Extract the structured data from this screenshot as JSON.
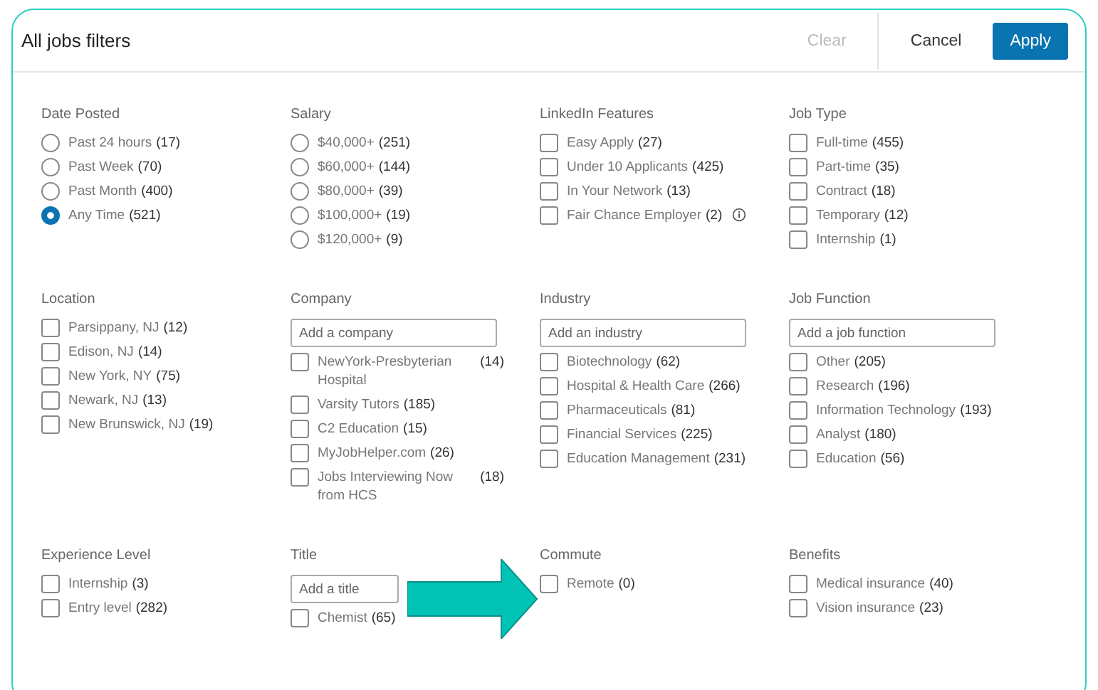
{
  "header": {
    "title": "All jobs filters",
    "buttons": [
      {
        "label": "Clear",
        "kind": "text",
        "disabled": true
      },
      {
        "label": "Cancel",
        "kind": "text",
        "disabled": false
      },
      {
        "label": "Apply",
        "kind": "primary",
        "disabled": false
      }
    ]
  },
  "rows": [
    [
      {
        "title": "Date Posted",
        "kind": "radio",
        "options": [
          {
            "label": "Past 24 hours",
            "count": "(17)",
            "selected": false
          },
          {
            "label": "Past Week",
            "count": "(70)",
            "selected": false
          },
          {
            "label": "Past Month",
            "count": "(400)",
            "selected": false
          },
          {
            "label": "Any Time",
            "count": "(521)",
            "selected": true
          }
        ]
      },
      {
        "title": "Salary",
        "kind": "radio",
        "options": [
          {
            "label": "$40,000+",
            "count": "(251)",
            "selected": false
          },
          {
            "label": "$60,000+",
            "count": "(144)",
            "selected": false
          },
          {
            "label": "$80,000+",
            "count": "(39)",
            "selected": false
          },
          {
            "label": "$100,000+",
            "count": "(19)",
            "selected": false
          },
          {
            "label": "$120,000+",
            "count": "(9)",
            "selected": false
          }
        ]
      },
      {
        "title": "LinkedIn Features",
        "kind": "checkbox",
        "options": [
          {
            "label": "Easy Apply",
            "count": "(27)",
            "checked": false
          },
          {
            "label": "Under 10 Applicants",
            "count": "(425)",
            "checked": false
          },
          {
            "label": "In Your Network",
            "count": "(13)",
            "checked": false
          },
          {
            "label": "Fair Chance Employer",
            "count": "(2)",
            "checked": false,
            "info_icon": true
          }
        ]
      },
      {
        "title": "Job Type",
        "kind": "checkbox",
        "options": [
          {
            "label": "Full-time",
            "count": "(455)",
            "checked": false
          },
          {
            "label": "Part-time",
            "count": "(35)",
            "checked": false
          },
          {
            "label": "Contract",
            "count": "(18)",
            "checked": false
          },
          {
            "label": "Temporary",
            "count": "(12)",
            "checked": false
          },
          {
            "label": "Internship",
            "count": "(1)",
            "checked": false
          }
        ]
      }
    ],
    [
      {
        "title": "Location",
        "kind": "checkbox",
        "options": [
          {
            "label": "Parsippany, NJ",
            "count": "(12)",
            "checked": false
          },
          {
            "label": "Edison, NJ",
            "count": "(14)",
            "checked": false
          },
          {
            "label": "New York, NY",
            "count": "(75)",
            "checked": false
          },
          {
            "label": "Newark, NJ",
            "count": "(13)",
            "checked": false
          },
          {
            "label": "New Brunswick, NJ",
            "count": "(19)",
            "checked": false
          }
        ]
      },
      {
        "title": "Company",
        "kind": "checkbox",
        "placeholder": "Add a company",
        "options": [
          {
            "label": "NewYork-Presbyterian Hospital",
            "count": "(14)",
            "checked": false
          },
          {
            "label": "Varsity Tutors",
            "count": "(185)",
            "checked": false
          },
          {
            "label": "C2 Education",
            "count": "(15)",
            "checked": false
          },
          {
            "label": "MyJobHelper.com",
            "count": "(26)",
            "checked": false
          },
          {
            "label": "Jobs Interviewing Now from HCS",
            "count": "(18)",
            "checked": false
          }
        ]
      },
      {
        "title": "Industry",
        "kind": "checkbox",
        "placeholder": "Add an industry",
        "options": [
          {
            "label": "Biotechnology",
            "count": "(62)",
            "checked": false
          },
          {
            "label": "Hospital & Health Care",
            "count": "(266)",
            "checked": false
          },
          {
            "label": "Pharmaceuticals",
            "count": "(81)",
            "checked": false
          },
          {
            "label": "Financial Services",
            "count": "(225)",
            "checked": false
          },
          {
            "label": "Education Management",
            "count": "(231)",
            "checked": false
          }
        ]
      },
      {
        "title": "Job Function",
        "kind": "checkbox",
        "placeholder": "Add a job function",
        "options": [
          {
            "label": "Other",
            "count": "(205)",
            "checked": false
          },
          {
            "label": "Research",
            "count": "(196)",
            "checked": false
          },
          {
            "label": "Information Technology",
            "count": "(193)",
            "checked": false
          },
          {
            "label": "Analyst",
            "count": "(180)",
            "checked": false
          },
          {
            "label": "Education",
            "count": "(56)",
            "checked": false
          }
        ]
      }
    ],
    [
      {
        "title": "Experience Level",
        "kind": "checkbox",
        "options": [
          {
            "label": "Internship",
            "count": "(3)",
            "checked": false
          },
          {
            "label": "Entry level",
            "count": "(282)",
            "checked": false
          }
        ]
      },
      {
        "title": "Title",
        "kind": "checkbox",
        "placeholder": "Add a title",
        "options": [
          {
            "label": "Chemist",
            "count": "(65)",
            "checked": false
          }
        ]
      },
      {
        "title": "Commute",
        "kind": "checkbox",
        "options": [
          {
            "label": "Remote",
            "count": "(0)",
            "checked": false
          }
        ]
      },
      {
        "title": "Benefits",
        "kind": "checkbox",
        "options": [
          {
            "label": "Medical insurance",
            "count": "(40)",
            "checked": false
          },
          {
            "label": "Vision insurance",
            "count": "(23)",
            "checked": false
          }
        ]
      }
    ]
  ]
}
